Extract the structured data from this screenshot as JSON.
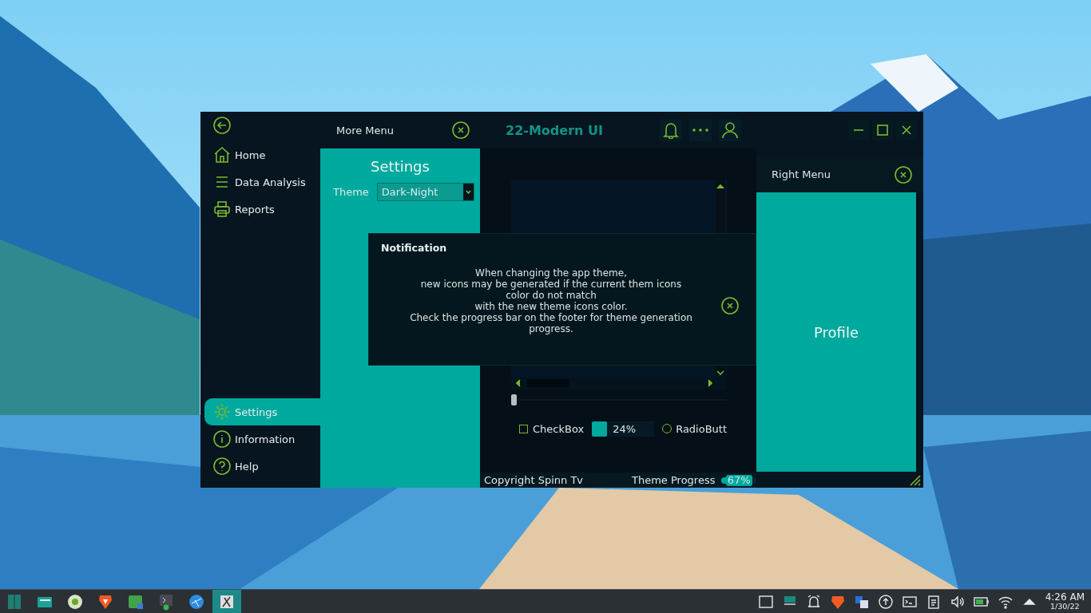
{
  "window": {
    "title": "22-Modern UI"
  },
  "left_menu": {
    "items": [
      {
        "label": "Home",
        "selected": false
      },
      {
        "label": "Data Analysis",
        "selected": false
      },
      {
        "label": "Reports",
        "selected": false
      }
    ],
    "bottom_items": [
      {
        "label": "Settings",
        "selected": true
      },
      {
        "label": "Information",
        "selected": false
      },
      {
        "label": "Help",
        "selected": false
      }
    ]
  },
  "more_menu": {
    "title": "More Menu",
    "heading": "Settings",
    "theme_label": "Theme",
    "theme_value": "Dark-Night"
  },
  "content": {
    "slider": {
      "level": 0
    },
    "checkbox": {
      "label": "CheckBox",
      "checked": false
    },
    "progress": {
      "level": 0.24,
      "reading": "24%"
    },
    "radio": {
      "label": "RadioButt",
      "checked": false
    }
  },
  "footer": {
    "copyright": "Copyright Spinn Tv",
    "progress_label": "Theme Progress",
    "progress": {
      "level": 0.67,
      "reading": "67%"
    }
  },
  "right_menu": {
    "title": "Right Menu",
    "profile": "Profile"
  },
  "notification": {
    "title": "Notification",
    "text": "When changing the app theme,\nnew icons may be generated if the current them icons\ncolor do not match\nwith the new theme icons color.\nCheck the progress bar on the footer for theme generation\nprogress."
  },
  "taskbar": {
    "time": "4:26 AM",
    "date": "1/30/22"
  }
}
